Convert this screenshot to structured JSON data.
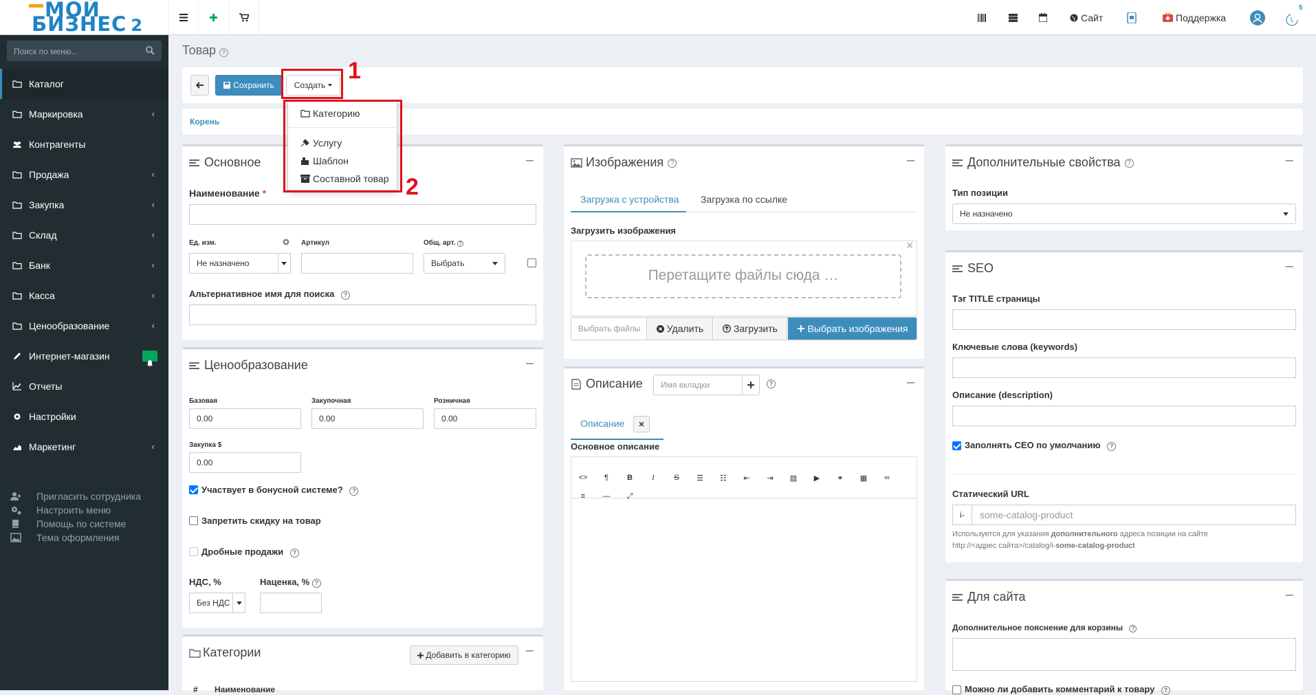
{
  "logo": {
    "line1": "МОЙ",
    "line2": "БИЗНЕС",
    "num": "2"
  },
  "sidebar": {
    "search_placeholder": "Поиск по меню...",
    "items": [
      {
        "label": "Каталог",
        "chev": ""
      },
      {
        "label": "Маркировка",
        "chev": "‹"
      },
      {
        "label": "Контрагенты",
        "chev": ""
      },
      {
        "label": "Продажа",
        "chev": "‹"
      },
      {
        "label": "Закупка",
        "chev": "‹"
      },
      {
        "label": "Склад",
        "chev": "‹"
      },
      {
        "label": "Банк",
        "chev": "‹"
      },
      {
        "label": "Касса",
        "chev": "‹"
      },
      {
        "label": "Ценообразование",
        "chev": "‹"
      },
      {
        "label": "Интернет-магазин",
        "chev": ""
      },
      {
        "label": "Отчеты",
        "chev": ""
      },
      {
        "label": "Настройки",
        "chev": ""
      },
      {
        "label": "Маркетинг",
        "chev": "‹"
      }
    ],
    "extra": [
      "Пригласить сотрудника",
      "Настроить меню",
      "Помощь по системе",
      "Тема оформления"
    ]
  },
  "topbar": {
    "site": "Сайт",
    "support": "Поддержка",
    "badge": "5"
  },
  "page": {
    "title": "Товар"
  },
  "toolbar": {
    "save": "Сохранить",
    "create": "Создать"
  },
  "dropdown": {
    "items": [
      "Категорию",
      "Услугу",
      "Шаблон",
      "Составной товар"
    ]
  },
  "annotations": {
    "n1": "1",
    "n2": "2"
  },
  "breadcrumb": "Корень",
  "basic": {
    "title": "Основное",
    "name_label": "Наименование",
    "required": "*",
    "unit_label": "Ед. изм.",
    "unit_value": "Не назначено",
    "article_label": "Артикул",
    "common_label": "Общ. арт.",
    "common_value": "Выбрать",
    "alt_label": "Альтернативное имя для поиска"
  },
  "pricing": {
    "title": "Ценообразование",
    "base_label": "Базовая",
    "base": "0.00",
    "purchase_label": "Закупочная",
    "purchase": "0.00",
    "retail_label": "Розничная",
    "retail": "0.00",
    "usd_label": "Закупка $",
    "usd": "0.00",
    "bonus": "Участвует в бонусной системе?",
    "no_discount": "Запретить скидку на товар",
    "fractional": "Дробные продажи",
    "vat_label": "НДС, %",
    "vat": "Без НДС",
    "markup_label": "Наценка, %"
  },
  "categories": {
    "title": "Категории",
    "add": "Добавить в категорию",
    "col": "Наименование",
    "hash": "#"
  },
  "images": {
    "title": "Изображения",
    "tab1": "Загрузка с устройства",
    "tab2": "Загрузка по ссылке",
    "upload_label": "Загрузить изображения",
    "drop": "Перетащите файлы сюда …",
    "choose": "Выбрать файлы",
    "delete": "Удалить",
    "upload": "Загрузить",
    "select_images": "Выбрать изображения"
  },
  "description": {
    "title": "Описание",
    "tab_placeholder": "Имя вкладки",
    "tab": "Описание",
    "main_label": "Основное описание"
  },
  "extra_props": {
    "title": "Дополнительные свойства",
    "type_label": "Тип позиции",
    "type_value": "Не назначено"
  },
  "seo": {
    "title": "SEO",
    "title_tag": "Тэг TITLE страницы",
    "keywords": "Ключевые слова (keywords)",
    "desc": "Описание (description)",
    "fill_default": "Заполнять СЕО по умолчанию",
    "static_url": "Статический URL",
    "prefix": "i-",
    "url_placeholder": "some-catalog-product",
    "note1": "Используется для указания ",
    "note_bold": "дополнительного",
    "note2": " адреса позиции на сайте",
    "note3": "http://<адрес сайта>/catalog/i-",
    "note3_bold": "some-catalog-product"
  },
  "for_site": {
    "title": "Для сайта",
    "cart_note": "Дополнительное пояснение для корзины",
    "comment": "Можно ли добавить комментарий к товару"
  }
}
